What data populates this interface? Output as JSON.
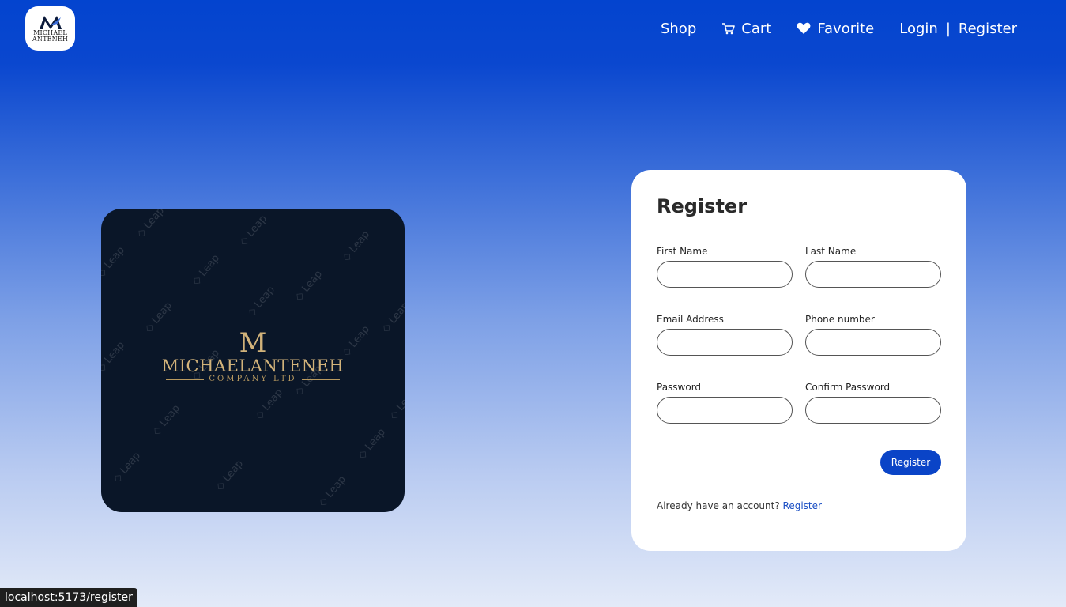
{
  "header": {
    "logo_line1": "MICHAEL",
    "logo_line2": "ANTENEH",
    "nav": {
      "shop": "Shop",
      "cart": "Cart",
      "favorite": "Favorite",
      "login": "Login",
      "separator": "|",
      "register": "Register"
    },
    "icons": {
      "cart": "cart-icon",
      "favorite": "heart-icon"
    }
  },
  "brand_image": {
    "monogram": "M",
    "name": "MICHAELANTENEH",
    "subtitle": "COMPANY LTD",
    "watermark": "Leap"
  },
  "form": {
    "title": "Register",
    "fields": {
      "first_name": {
        "label": "First Name",
        "value": "",
        "placeholder": ""
      },
      "last_name": {
        "label": "Last Name",
        "value": "",
        "placeholder": ""
      },
      "email": {
        "label": "Email Address",
        "value": "",
        "placeholder": ""
      },
      "phone": {
        "label": "Phone number",
        "value": "",
        "placeholder": ""
      },
      "password": {
        "label": "Password",
        "value": "",
        "placeholder": ""
      },
      "confirm_password": {
        "label": "Confirm Password",
        "value": "",
        "placeholder": ""
      }
    },
    "submit_label": "Register",
    "footer_text": "Already have an account?",
    "footer_link": "Register"
  },
  "status_bar": {
    "url": "localhost:5173/register"
  },
  "colors": {
    "header_blue": "#0344cf",
    "button_blue": "#0a44c7",
    "link_blue": "#1b4fc4",
    "brand_bg": "#0a1628",
    "brand_gold": "#d1b27a"
  }
}
